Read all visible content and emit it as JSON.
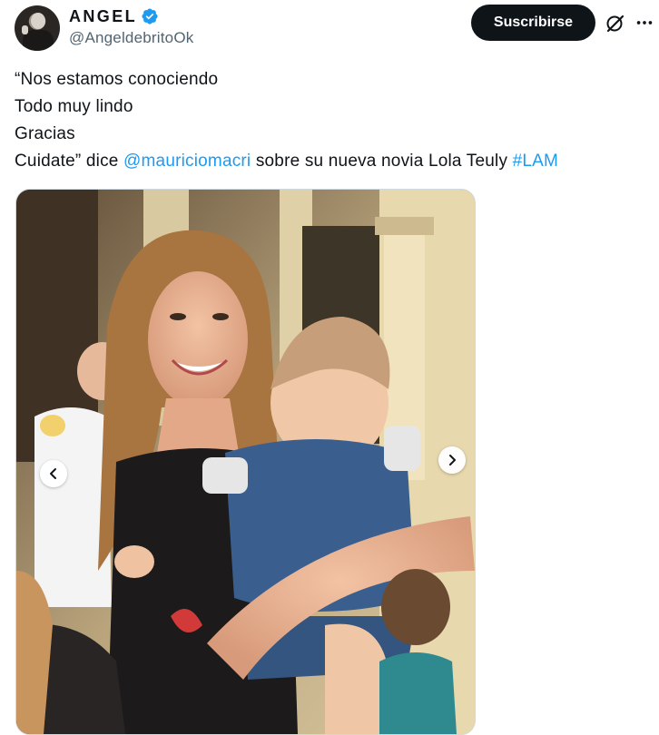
{
  "author": {
    "display_name": "ANGEL",
    "handle": "@AngeldebritoOk",
    "avatar_icon": "person-avatar",
    "verified_icon": "verified-badge-icon",
    "verified_color": "#1d9bf0"
  },
  "actions": {
    "subscribe_label": "Suscribirse",
    "grok_icon": "grok-icon",
    "more_icon": "more-options-icon"
  },
  "tweet": {
    "line1": "“Nos estamos conociendo",
    "line2": "Todo muy lindo",
    "line3": "Gracias",
    "line4_prefix": "Cuidate” dice ",
    "mention": "@mauriciomacri",
    "line4_middle": " sobre su nueva novia Lola Teuly ",
    "hashtag": "#LAM"
  },
  "media": {
    "carousel_prev_icon": "chevron-left-icon",
    "carousel_next_icon": "chevron-right-icon"
  },
  "colors": {
    "text": "#0f1419",
    "secondary": "#536471",
    "link": "#1d9bf0",
    "button_bg": "#0f1419"
  }
}
